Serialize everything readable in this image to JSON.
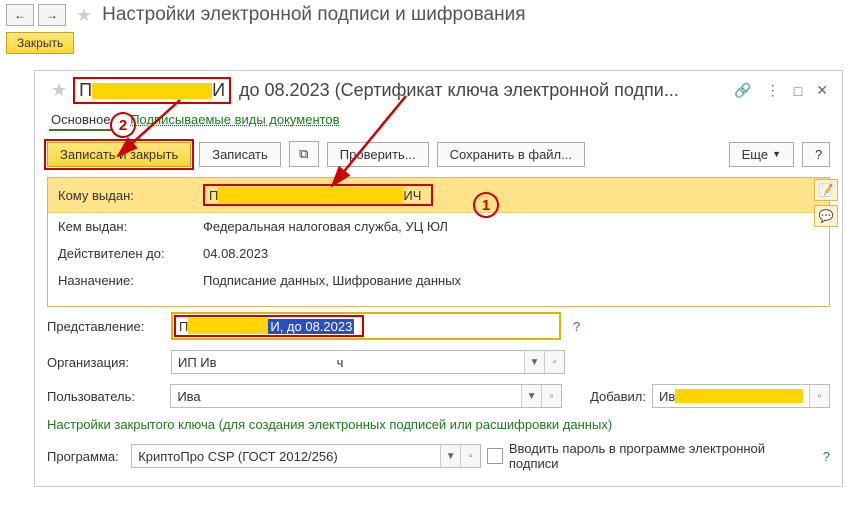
{
  "page": {
    "title": "Настройки электронной подписи и шифрования",
    "close_btn": "Закрыть"
  },
  "dialog": {
    "title_prefix": "П",
    "title_suffix": "И",
    "title_rest": " до 08.2023 (Сертификат ключа электронной подпи...",
    "tabs": {
      "main": "Основное",
      "docs": "Подписываемые виды документов"
    },
    "toolbar": {
      "save_close": "Записать и закрыть",
      "save": "Записать",
      "check": "Проверить...",
      "save_file": "Сохранить в файл...",
      "more": "Еще",
      "help": "?"
    },
    "info": {
      "issued_to_label": "Кому выдан:",
      "issued_to_prefix": "П",
      "issued_to_suffix": "ИЧ",
      "issued_by_label": "Кем выдан:",
      "issued_by_value": "Федеральная налоговая служба, УЦ ЮЛ",
      "valid_label": "Действителен до:",
      "valid_value": "04.08.2023",
      "purpose_label": "Назначение:",
      "purpose_value": "Подписание данных, Шифрование данных"
    },
    "form": {
      "repr_label": "Представление:",
      "repr_prefix": "П",
      "repr_sel": "И, до 08.2023",
      "org_label": "Организация:",
      "org_prefix": "ИП Ив",
      "org_suffix": "ч",
      "user_label": "Пользователь:",
      "user_prefix": "Ива",
      "added_label": "Добавил:",
      "added_prefix": "Ив",
      "key_link": "Настройки закрытого ключа (для создания электронных подписей или расшифровки данных)",
      "prog_label": "Программа:",
      "prog_value": "КриптоПро CSP (ГОСТ 2012/256)",
      "pwd_checkbox": "Вводить пароль в программе электронной подписи"
    },
    "annotations": {
      "n1": "1",
      "n2": "2"
    }
  }
}
